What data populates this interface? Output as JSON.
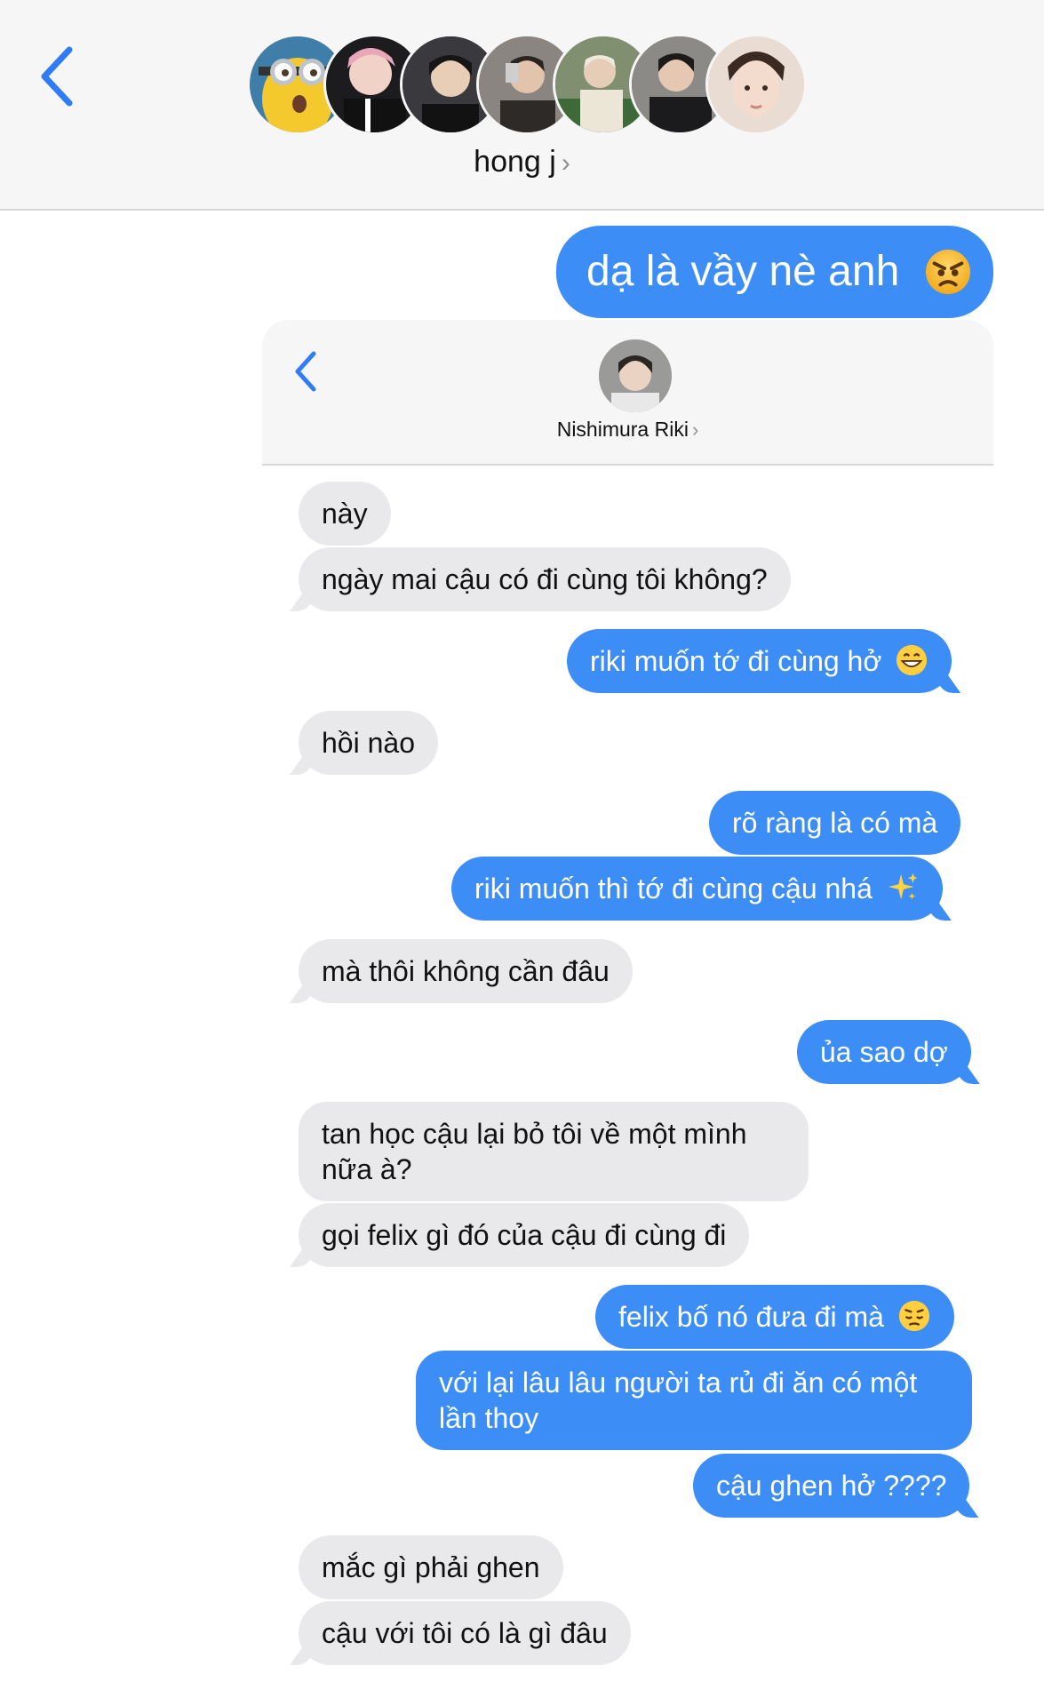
{
  "header": {
    "group_name": "hong j",
    "chevron": "›",
    "avatars": [
      {
        "name": "minion-avatar",
        "color": "#f3c92e"
      },
      {
        "name": "member-avatar-2",
        "color": "#d9a8b8"
      },
      {
        "name": "member-avatar-3",
        "color": "#3a3a3e"
      },
      {
        "name": "member-avatar-4",
        "color": "#6f6a66"
      },
      {
        "name": "member-avatar-5",
        "color": "#8f9a84"
      },
      {
        "name": "member-avatar-6",
        "color": "#4d4b50"
      },
      {
        "name": "member-avatar-7",
        "color": "#e7d8cf"
      }
    ]
  },
  "top_message": {
    "text": "dạ là vầy nè anh",
    "emoji": "angry-face-emoji"
  },
  "inner_screenshot": {
    "contact_name": "Nishimura Riki",
    "chevron": "›",
    "messages": [
      {
        "side": "recv",
        "text": "này"
      },
      {
        "side": "recv",
        "text": "ngày mai cậu có đi cùng tôi không?"
      },
      {
        "side": "sent",
        "text": "riki muốn tớ đi cùng hở",
        "emoji": "grinning-face-emoji"
      },
      {
        "side": "recv",
        "text": "hồi nào"
      },
      {
        "side": "sent",
        "text": "rõ ràng là có mà"
      },
      {
        "side": "sent",
        "text": "riki muốn thì tớ đi cùng cậu nhá",
        "emoji": "sparkles-emoji"
      },
      {
        "side": "recv",
        "text": "mà thôi không cần đâu"
      },
      {
        "side": "sent",
        "text": "ủa sao dợ"
      },
      {
        "side": "recv",
        "text": "tan học cậu lại bỏ tôi về một mình nữa à?",
        "line1": "tan học cậu lại bỏ tôi về một mình",
        "line2": "nữa à?"
      },
      {
        "side": "recv",
        "text": "gọi felix gì đó của cậu đi cùng đi"
      },
      {
        "side": "sent",
        "text": "felix bố nó đưa đi mà",
        "emoji": "pensive-face-emoji"
      },
      {
        "side": "sent",
        "text": "với lại lâu lâu người ta rủ đi ăn có một lần thoy",
        "line1": "với lại lâu lâu người ta rủ đi ăn có một",
        "line2": "lần thoy"
      },
      {
        "side": "sent",
        "text": "cậu ghen hở ????"
      },
      {
        "side": "recv",
        "text": "mắc gì phải ghen"
      },
      {
        "side": "recv",
        "text": "cậu với tôi có là gì đâu"
      }
    ]
  },
  "colors": {
    "sent_bubble": "#3c8df5",
    "recv_bubble": "#e9e9eb",
    "accent_blue": "#2f7cf6"
  }
}
